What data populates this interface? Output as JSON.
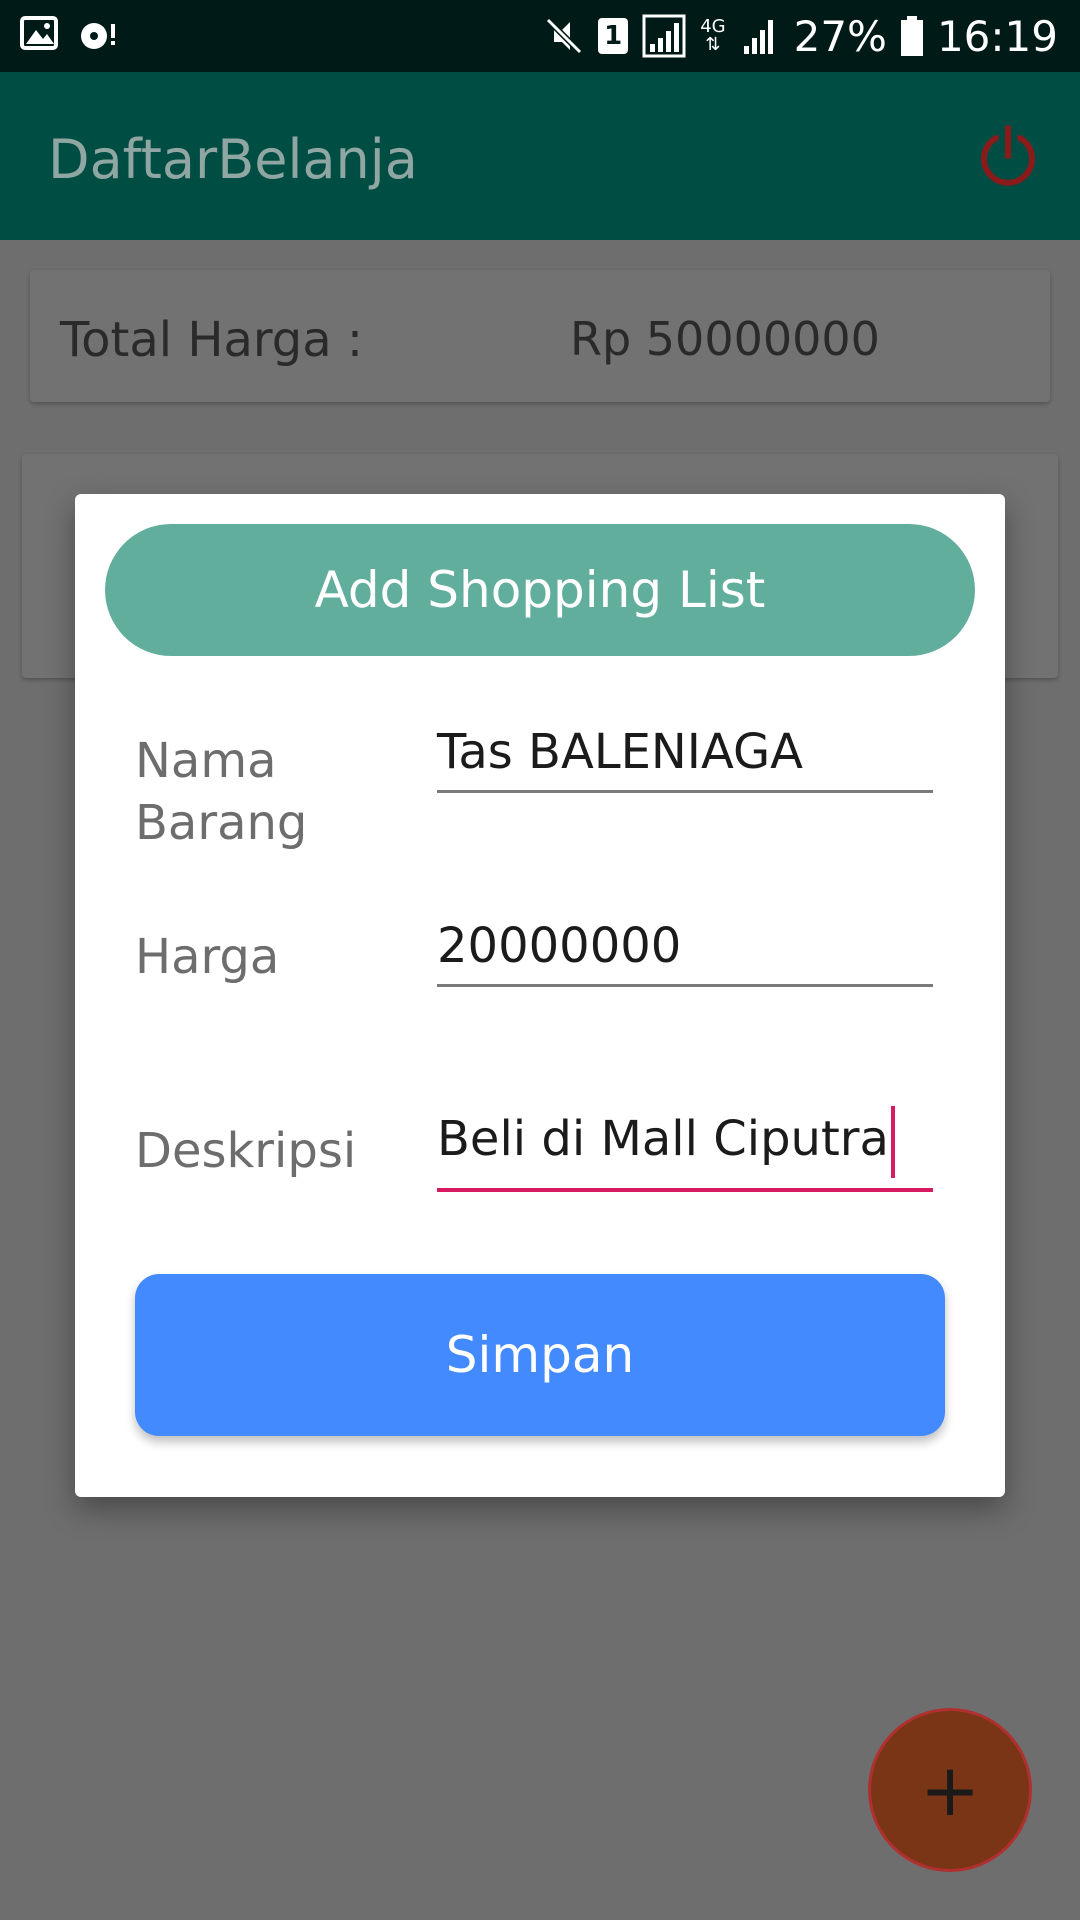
{
  "status_bar": {
    "battery": "27%",
    "time": "16:19",
    "sim_slot": "1",
    "network": "4G"
  },
  "app_bar": {
    "title": "DaftarBelanja",
    "power_icon": "power-icon"
  },
  "summary": {
    "label": "Total Harga :",
    "value": "Rp 50000000"
  },
  "dialog": {
    "title": "Add Shopping List",
    "fields": {
      "name": {
        "label_line1": "Nama",
        "label_line2": "Barang",
        "value": "Tas BALENIAGA"
      },
      "price": {
        "label": "Harga",
        "value": "20000000"
      },
      "description": {
        "label": "Deskripsi",
        "value": "Beli di Mall Ciputra"
      }
    },
    "save_label": "Simpan"
  },
  "fab": {
    "label": "+",
    "icon": "plus-icon"
  },
  "colors": {
    "app_bar": "#004d44",
    "dialog_header": "#62ae9c",
    "save_button": "#448aff",
    "active_underline": "#d81b60",
    "fab": "#7a3516"
  }
}
